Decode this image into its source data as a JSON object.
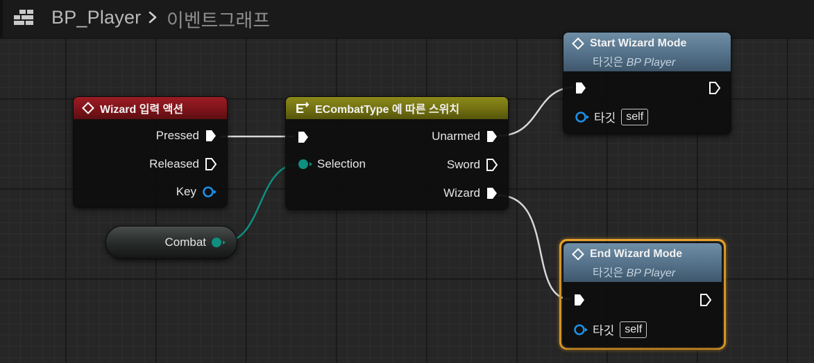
{
  "header": {
    "blueprint_name": "BP_Player",
    "graph_name": "이벤트그래프",
    "icon": "blueprint-grid-icon",
    "separator_icon": "chevron-right-icon"
  },
  "nodes": {
    "input_action": {
      "title": "Wizard 입력 액션",
      "icon": "event-diamond-icon",
      "pins": {
        "pressed": "Pressed",
        "released": "Released",
        "key": "Key"
      }
    },
    "switch": {
      "title": "ECombatType 에 따른 스위치",
      "icon": "switch-enum-icon",
      "pins": {
        "selection": "Selection",
        "unarmed": "Unarmed",
        "sword": "Sword",
        "wizard": "Wizard"
      }
    },
    "combat_var": {
      "label": "Combat"
    },
    "start_wizard": {
      "title": "Start Wizard Mode",
      "subtitle_prefix": "타깃은",
      "subtitle_target": "BP Player",
      "target_label": "타깃",
      "target_value": "self"
    },
    "end_wizard": {
      "title": "End Wizard Mode",
      "subtitle_prefix": "타깃은",
      "subtitle_target": "BP Player",
      "target_label": "타깃",
      "target_value": "self",
      "selected": true
    }
  },
  "colors": {
    "exec_pin": "#ffffff",
    "enum_pin": "#0e8f7f",
    "object_pin": "#1e8fe6",
    "selection_outline": "#f0a72c",
    "input_title": "#9c1c24",
    "switch_title": "#8c8a1a",
    "function_title": "#6f8ea6"
  }
}
